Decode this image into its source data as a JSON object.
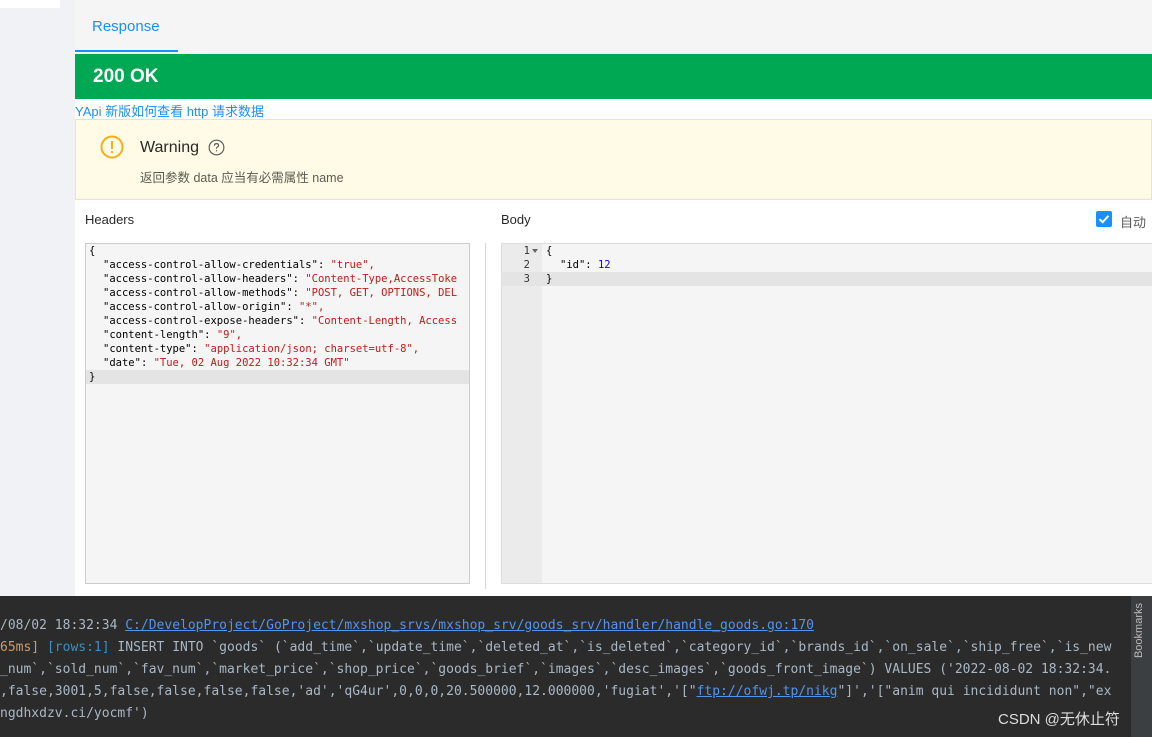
{
  "tab_label": "Response",
  "status_text": "200 OK",
  "help_link": "YApi 新版如何查看 http 请求数据",
  "warning": {
    "title": "Warning",
    "description": "返回参数 data 应当有必需属性 name"
  },
  "headers_label": "Headers",
  "body_label": "Body",
  "auto_label": "自动",
  "headers_json": {
    "open": "{",
    "lines": [
      {
        "key": "\"access-control-allow-credentials\"",
        "value": "\"true\","
      },
      {
        "key": "\"access-control-allow-headers\"",
        "value": "\"Content-Type,AccessToke"
      },
      {
        "key": "\"access-control-allow-methods\"",
        "value": "\"POST, GET, OPTIONS, DEL"
      },
      {
        "key": "\"access-control-allow-origin\"",
        "value": "\"*\","
      },
      {
        "key": "\"access-control-expose-headers\"",
        "value": "\"Content-Length, Access"
      },
      {
        "key": "\"content-length\"",
        "value": "\"9\","
      },
      {
        "key": "\"content-type\"",
        "value": "\"application/json; charset=utf-8\","
      },
      {
        "key": "\"date\"",
        "value": "\"Tue, 02 Aug 2022 10:32:34 GMT\""
      }
    ],
    "close": "}"
  },
  "body_json": {
    "line_numbers": [
      "1",
      "2",
      "3"
    ],
    "open": "{",
    "key": "\"id\"",
    "value": "12",
    "close": "}"
  },
  "console": {
    "l1_time": "/08/02 18:32:34 ",
    "l1_path": "C:/DevelopProject/GoProject/mxshop_srvs/mxshop_srv/goods_srv/handler/handle_goods.go:170",
    "l2_ms": "65ms]",
    "l2_rows": " [rows:1]",
    "l2_sql": " INSERT INTO `goods` (`add_time`,`update_time`,`deleted_at`,`is_deleted`,`category_id`,`brands_id`,`on_sale`,`ship_free`,`is_new",
    "l3": "_num`,`sold_num`,`fav_num`,`market_price`,`shop_price`,`goods_brief`,`images`,`desc_images`,`goods_front_image`) VALUES ('2022-08-02 18:32:34.",
    "l4_a": ",false,3001,5,false,false,false,false,'ad','qG4ur',0,0,0,20.500000,12.000000,'fugiat','[\"",
    "l4_link": "ftp://ofwj.tp/nikg",
    "l4_b": "\"]','[\"anim qui incididunt non\",\"ex",
    "l5": "ngdhxdzv.ci/yocmf')"
  },
  "side_label": "Bookmarks",
  "watermark": "CSDN @无休止符"
}
